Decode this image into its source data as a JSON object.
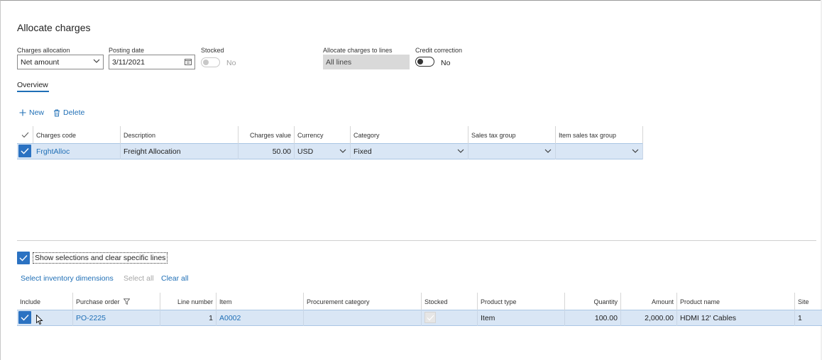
{
  "page": {
    "title": "Allocate charges"
  },
  "form": {
    "charges_allocation": {
      "label": "Charges allocation",
      "value": "Net amount"
    },
    "posting_date": {
      "label": "Posting date",
      "value": "3/11/2021"
    },
    "stocked": {
      "label": "Stocked",
      "value": "No"
    },
    "allocate_lines": {
      "label": "Allocate charges to lines",
      "value": "All lines"
    },
    "credit_correction": {
      "label": "Credit correction",
      "value": "No"
    }
  },
  "tabs": {
    "overview": "Overview"
  },
  "toolbar": {
    "new_label": "New",
    "delete_label": "Delete"
  },
  "charges_grid": {
    "columns": [
      "Charges code",
      "Description",
      "Charges value",
      "Currency",
      "Category",
      "Sales tax group",
      "Item sales tax group"
    ],
    "row": {
      "charges_code": "FrghtAlloc",
      "description": "Freight Allocation",
      "charges_value": "50.00",
      "currency": "USD",
      "category": "Fixed",
      "sales_tax_group": "",
      "item_sales_tax_group": ""
    }
  },
  "selection": {
    "show_label": "Show selections and clear specific lines",
    "select_dims": "Select inventory dimensions",
    "select_all": "Select all",
    "clear_all": "Clear all"
  },
  "lines_grid": {
    "columns": [
      "Include",
      "Purchase order",
      "Line number",
      "Item",
      "Procurement category",
      "Stocked",
      "Product type",
      "Quantity",
      "Amount",
      "Product name",
      "Site"
    ],
    "row": {
      "purchase_order": "PO-2225",
      "line_number": "1",
      "item": "A0002",
      "procurement_category": "",
      "product_type": "Item",
      "quantity": "100.00",
      "amount": "2,000.00",
      "product_name": "HDMI 12' Cables",
      "site": "1"
    }
  },
  "colors": {
    "accent": "#1f6fb6",
    "selected_row": "#d9e6f5",
    "checkbox": "#2b72c2"
  }
}
